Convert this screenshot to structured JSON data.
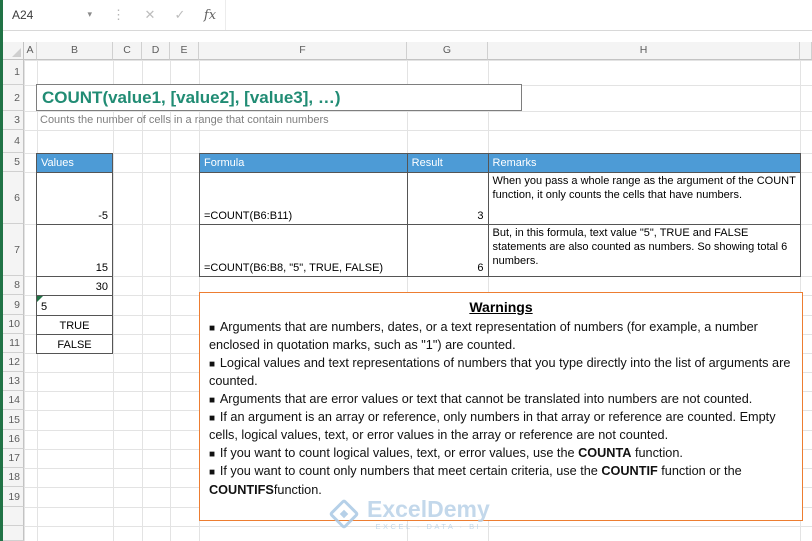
{
  "colors": {
    "excel_green": "#217346",
    "header_blue": "#4D9BD6",
    "title_teal": "#218C74",
    "warning_border": "#ED7D31",
    "watermark_blue": "#B9D2E8"
  },
  "formula_bar": {
    "name_box": "A24",
    "cancel_icon": "✕",
    "enter_icon": "✓",
    "insert_function_label": "fx",
    "formula_value": ""
  },
  "sheet": {
    "columns": [
      "A",
      "B",
      "C",
      "D",
      "E",
      "F",
      "G",
      "H"
    ],
    "rows": [
      "1",
      "2",
      "3",
      "4",
      "5",
      "6",
      "7",
      "8",
      "9",
      "10",
      "11",
      "12",
      "13",
      "14",
      "15",
      "16",
      "17",
      "18",
      "19"
    ],
    "title": "COUNT(value1, [value2], [value3], …)",
    "subtitle": "Counts the number of cells in a range that contain numbers"
  },
  "values_table": {
    "header": "Values",
    "cells": [
      {
        "v": "-5",
        "align": "right"
      },
      {
        "v": "15",
        "align": "right"
      },
      {
        "v": "30",
        "align": "right"
      },
      {
        "v": "5",
        "align": "left",
        "error_flag": true
      },
      {
        "v": "TRUE",
        "align": "center"
      },
      {
        "v": "FALSE",
        "align": "center"
      }
    ]
  },
  "formula_table": {
    "headers": [
      "Formula",
      "Result",
      "Remarks"
    ],
    "rows": [
      {
        "formula": "=COUNT(B6:B11)",
        "result": "3",
        "remarks": "When you pass a whole range as the argument of the COUNT function, it only counts the cells that have numbers."
      },
      {
        "formula": "=COUNT(B6:B8, \"5\", TRUE, FALSE)",
        "result": "6",
        "remarks": "But, in this formula, text value \"5\", TRUE and FALSE statements are also counted as numbers. So showing total 6 numbers."
      }
    ]
  },
  "warnings": {
    "title": "Warnings",
    "bullet": "■",
    "items": [
      [
        {
          "t": "Arguments that are numbers, dates, or a text representation of numbers (for example, a number enclosed in quotation marks, such as \"1\") are counted."
        }
      ],
      [
        {
          "t": "Logical values and text representations of numbers that you type directly into the list of arguments are counted."
        }
      ],
      [
        {
          "t": "Arguments that are error values or text that cannot be translated into numbers are not counted."
        }
      ],
      [
        {
          "t": "If an argument is an array or reference, only numbers in that array or reference are counted. Empty cells, logical values, text, or error values in the array or reference are not counted."
        }
      ],
      [
        {
          "t": "If you want to count logical values, text, or error values, use the "
        },
        {
          "t": "COUNTA",
          "b": true
        },
        {
          "t": " function."
        }
      ],
      [
        {
          "t": "If you want to count only numbers that meet certain criteria, use the "
        },
        {
          "t": "COUNTIF",
          "b": true
        },
        {
          "t": " function or the "
        },
        {
          "t": "COUNTIFS",
          "b": true
        },
        {
          "t": "function."
        }
      ]
    ]
  },
  "watermark": {
    "name": "ExcelDemy",
    "tagline": "EXCEL · DATA · BI"
  }
}
